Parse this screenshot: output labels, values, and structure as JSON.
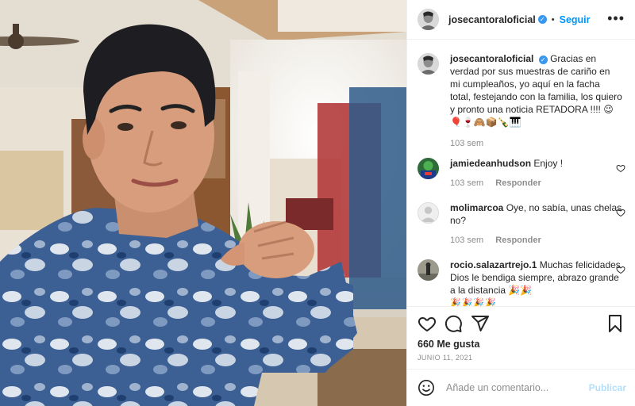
{
  "post": {
    "author": "josecantoraloficial",
    "follow_label": "Seguir",
    "separator": "•",
    "more_label": "•••",
    "verified_mark": "✓"
  },
  "caption": {
    "username": "josecantoraloficial",
    "text": "Gracias en verdad por sus muestras de cariño en mi cumpleaños, yo aquí en la facha total, festejando con la familia, los quiero y pronto una noticia RETADORA !!!! 😉🎈🍷🙈📦🍾🎹",
    "time": "103 sem"
  },
  "comments": [
    {
      "username": "jamiedeanhudson",
      "text": "Enjoy !",
      "time": "103 sem",
      "reply": "Responder"
    },
    {
      "username": "molimarcoa",
      "text": "Oye, no sabía, unas chelas no?",
      "time": "103 sem",
      "reply": "Responder"
    },
    {
      "username": "rocio.salazartrejo.1",
      "text": "Muchas felicidades Dios le bendiga siempre, abrazo grande a la distancia 🎉🎉",
      "emoji_line": "🎉🎉🎉🎉",
      "time": "",
      "reply": ""
    }
  ],
  "stats": {
    "likes": "660 Me gusta",
    "date": "JUNIO 11, 2021"
  },
  "composer": {
    "placeholder": "Añade un comentario...",
    "publish_label": "Publicar"
  },
  "colors": {
    "accent": "#0095f6",
    "verified": "#3897f0",
    "muted": "#8e8e8e"
  }
}
